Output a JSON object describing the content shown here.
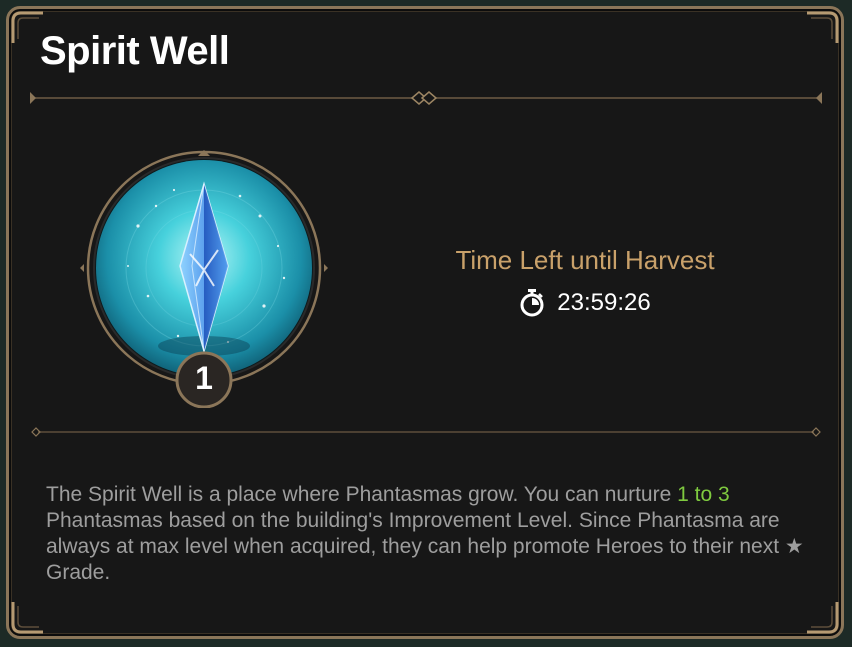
{
  "colors": {
    "panel_bg": "#171717",
    "border": "#8b7659",
    "title": "#ffffff",
    "timer_label": "#c9a16a",
    "description": "#9e9e9e",
    "highlight": "#7fca3f"
  },
  "panel": {
    "title": "Spirit Well"
  },
  "building": {
    "icon": "spirit-crystal",
    "level": "1"
  },
  "timer": {
    "label": "Time Left until Harvest",
    "icon": "stopwatch-icon",
    "value": "23:59:26"
  },
  "description": {
    "part1": "The Spirit Well is a place where Phantasmas grow. You can nurture ",
    "highlight": "1 to 3",
    "part2": " Phantasmas based on the building's Improvement Level. Since Phantasma are always at max level when acquired, they can help promote Heroes to their next ★ Grade."
  }
}
